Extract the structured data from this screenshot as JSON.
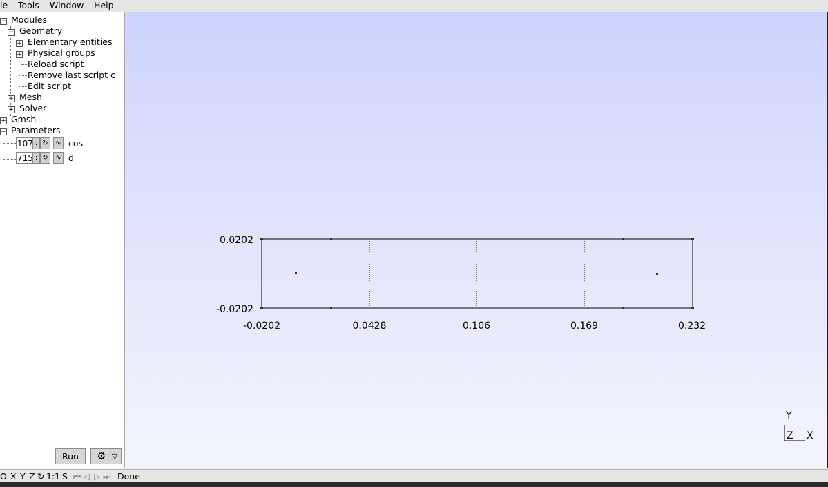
{
  "menu": {
    "file": "le",
    "tools": "Tools",
    "window": "Window",
    "help": "Help"
  },
  "tree": {
    "modules": "Modules",
    "geometry": "Geometry",
    "elementary_entities": "Elementary entities",
    "physical_groups": "Physical groups",
    "reload_script": "Reload script",
    "remove_last": "Remove last script co",
    "edit_script": "Edit script",
    "mesh": "Mesh",
    "solver": "Solver",
    "gmsh": "Gmsh",
    "parameters": "Parameters"
  },
  "parameters": [
    {
      "value": "107",
      "name": "cos"
    },
    {
      "value": "715",
      "name": "d"
    }
  ],
  "buttons": {
    "run": "Run",
    "expand_glyph": "▽",
    "plus": "+",
    "minus": "−"
  },
  "axes": {
    "y_top": "0.0202",
    "y_bottom": "-0.0202",
    "x_ticks": [
      "-0.0202",
      "0.0428",
      "0.106",
      "0.169",
      "0.232"
    ]
  },
  "axis_triad": {
    "y": "Y",
    "z": "Z",
    "x": "X"
  },
  "status": {
    "o": "O",
    "x": "X",
    "y": "Y",
    "z": "Z",
    "scale": "1:1",
    "s": "S",
    "message": "Done"
  },
  "colors": {
    "background_top": "#cdd3fd",
    "background_bottom": "#f4f5fd",
    "geometry_lines": "#000000"
  }
}
